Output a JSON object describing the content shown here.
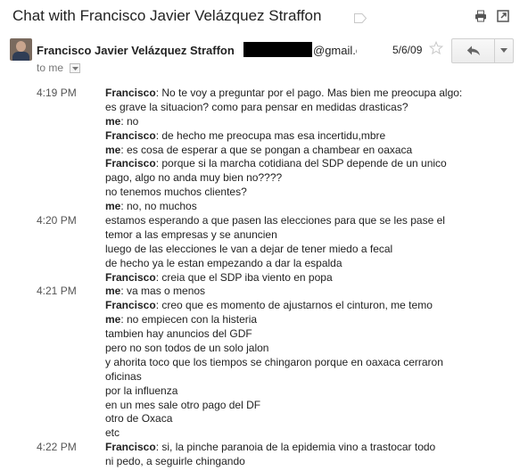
{
  "header": {
    "subject": "Chat with Francisco Javier Velázquez Straffon",
    "icons": [
      "label-icon",
      "print-icon",
      "new-window-icon"
    ]
  },
  "message": {
    "sender_name": "Francisco Javier Velázquez Straffon",
    "email_domain": "@gmail.com",
    "date": "5/6/09",
    "to_label": "to me",
    "icons": [
      "avatar",
      "star-icon",
      "reply-icon",
      "dropdown-arrow-icon"
    ]
  },
  "chat": [
    {
      "time": "4:19 PM",
      "speaker": "Francisco",
      "text": ": No te voy a preguntar por el pago. Mas bien me preocupa algo:"
    },
    {
      "time": "",
      "speaker": "",
      "text": "es grave la situacion? como para pensar en medidas drasticas?"
    },
    {
      "time": "",
      "speaker": "me",
      "text": ": no"
    },
    {
      "time": "",
      "speaker": "Francisco",
      "text": ": de hecho me preocupa mas esa incertidu,mbre"
    },
    {
      "time": "",
      "speaker": "me",
      "text": ": es cosa de esperar a que se pongan a chambear en oaxaca"
    },
    {
      "time": "",
      "speaker": "Francisco",
      "text": ": porque si la marcha cotidiana del SDP depende de un unico"
    },
    {
      "time": "",
      "speaker": "",
      "text": "pago, algo no anda muy bien no????"
    },
    {
      "time": "",
      "speaker": "",
      "text": "no tenemos muchos clientes?"
    },
    {
      "time": "",
      "speaker": "me",
      "text": ": no, no muchos"
    },
    {
      "time": "4:20 PM",
      "speaker": "",
      "text": "estamos esperando a que pasen las elecciones para que se les pase el"
    },
    {
      "time": "",
      "speaker": "",
      "text": "temor a las empresas y se anuncien"
    },
    {
      "time": "",
      "speaker": "",
      "text": "luego de las elecciones le van a dejar de tener miedo a fecal"
    },
    {
      "time": "",
      "speaker": "",
      "text": "de hecho ya le estan empezando a dar la espalda"
    },
    {
      "time": "",
      "speaker": "Francisco",
      "text": ": creia que el SDP iba viento en popa"
    },
    {
      "time": "4:21 PM",
      "speaker": "me",
      "text": ": va mas o menos"
    },
    {
      "time": "",
      "speaker": "Francisco",
      "text": ": creo que es momento de ajustarnos el cinturon, me temo"
    },
    {
      "time": "",
      "speaker": "me",
      "text": ": no empiecen con la histeria"
    },
    {
      "time": "",
      "speaker": "",
      "text": "tambien hay anuncios del GDF"
    },
    {
      "time": "",
      "speaker": "",
      "text": "pero no son todos de un solo jalon"
    },
    {
      "time": "",
      "speaker": "",
      "text": "y ahorita toco que los tiempos se chingaron porque en oaxaca cerraron"
    },
    {
      "time": "",
      "speaker": "",
      "text": "oficinas"
    },
    {
      "time": "",
      "speaker": "",
      "text": "por la influenza"
    },
    {
      "time": "",
      "speaker": "",
      "text": "en un mes sale otro pago del DF"
    },
    {
      "time": "",
      "speaker": "",
      "text": "otro de Oxaca"
    },
    {
      "time": "",
      "speaker": "",
      "text": "etc"
    },
    {
      "time": "4:22 PM",
      "speaker": "Francisco",
      "text": ": si, la pinche paranoia de la epidemia vino a trastocar todo"
    },
    {
      "time": "",
      "speaker": "",
      "text": "ni pedo, a seguirle chingando"
    }
  ]
}
